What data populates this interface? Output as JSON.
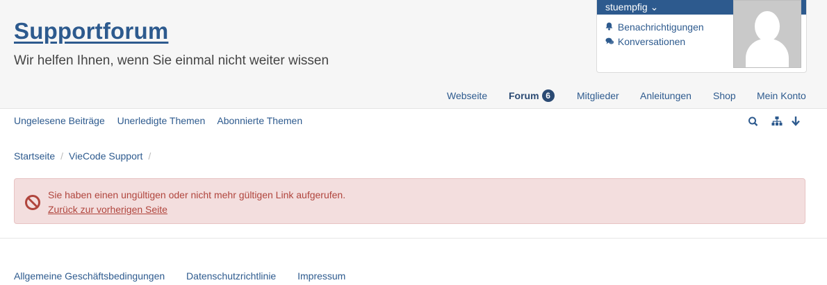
{
  "header": {
    "logo": "Supportforum",
    "tagline": "Wir helfen Ihnen, wenn Sie einmal nicht weiter wissen"
  },
  "user": {
    "name": "stuempfig",
    "chevron": "⌄",
    "links": [
      {
        "label": "Benachrichtigungen",
        "icon": "bell-icon"
      },
      {
        "label": "Konversationen",
        "icon": "chat-icon"
      }
    ]
  },
  "nav": {
    "items": [
      {
        "label": "Webseite"
      },
      {
        "label": "Forum",
        "badge": "6",
        "active": true
      },
      {
        "label": "Mitglieder"
      },
      {
        "label": "Anleitungen"
      },
      {
        "label": "Shop"
      },
      {
        "label": "Mein Konto"
      }
    ]
  },
  "subnav": {
    "items": [
      "Ungelesene Beiträge",
      "Unerledigte Themen",
      "Abonnierte Themen"
    ],
    "icons": [
      "search-icon",
      "sitemap-icon",
      "arrow-down-icon"
    ]
  },
  "breadcrumb": [
    "Startseite",
    "VieCode Support"
  ],
  "alert": {
    "message": "Sie haben einen ungültigen oder nicht mehr gültigen Link aufgerufen.",
    "link": "Zurück zur vorherigen Seite",
    "icon": "forbidden-icon",
    "color": "#b0453d"
  },
  "footer": [
    "Allgemeine Geschäftsbedingungen",
    "Datenschutzrichtlinie",
    "Impressum"
  ],
  "colors": {
    "accent": "#2d5a8e",
    "alert_bg": "#f3dede"
  }
}
